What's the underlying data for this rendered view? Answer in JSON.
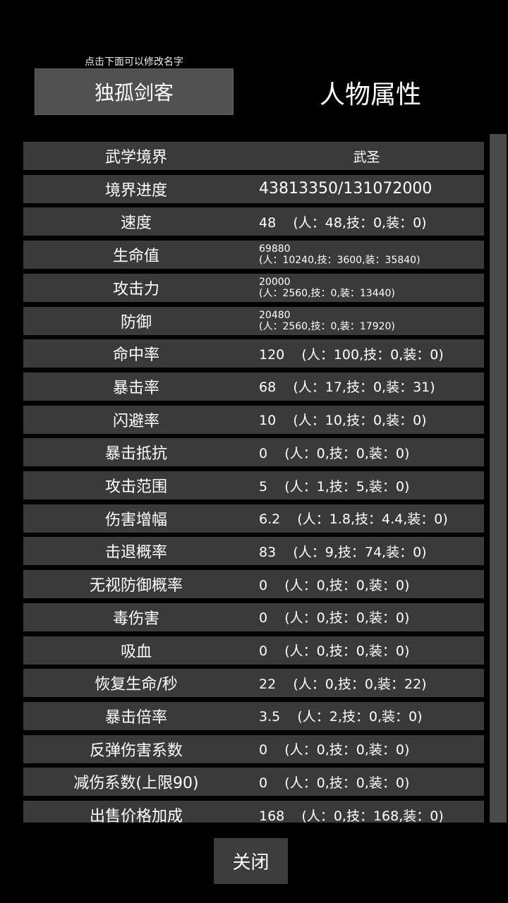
{
  "header": {
    "hint": "点击下面可以修改名字",
    "name": "独孤剑客",
    "title": "人物属性"
  },
  "stats": [
    {
      "label": "武学境界",
      "value": "武圣",
      "style": "center"
    },
    {
      "label": "境界进度",
      "value": "43813350/131072000",
      "style": "big"
    },
    {
      "label": "速度",
      "value": "48    (人：48,技：0,装：0)"
    },
    {
      "label": "生命值",
      "value": "69880",
      "value2": "(人：10240,技：3600,装：35840)",
      "style": "two"
    },
    {
      "label": "攻击力",
      "value": "20000",
      "value2": "(人：2560,技：0,装：13440)",
      "style": "two"
    },
    {
      "label": "防御",
      "value": "20480",
      "value2": "(人：2560,技：0,装：17920)",
      "style": "two"
    },
    {
      "label": "命中率",
      "value": "120    (人：100,技：0,装：0)"
    },
    {
      "label": "暴击率",
      "value": "68    (人：17,技：0,装：31)"
    },
    {
      "label": "闪避率",
      "value": "10    (人：10,技：0,装：0)"
    },
    {
      "label": "暴击抵抗",
      "value": "0    (人：0,技：0,装：0)"
    },
    {
      "label": "攻击范围",
      "value": "5    (人：1,技：5,装：0)"
    },
    {
      "label": "伤害增幅",
      "value": "6.2    (人：1.8,技：4.4,装：0)"
    },
    {
      "label": "击退概率",
      "value": "83    (人：9,技：74,装：0)"
    },
    {
      "label": "无视防御概率",
      "value": "0    (人：0,技：0,装：0)"
    },
    {
      "label": "毒伤害",
      "value": "0    (人：0,技：0,装：0)"
    },
    {
      "label": "吸血",
      "value": "0    (人：0,技：0,装：0)"
    },
    {
      "label": "恢复生命/秒",
      "value": "22    (人：0,技：0,装：22)"
    },
    {
      "label": "暴击倍率",
      "value": "3.5    (人：2,技：0,装：0)"
    },
    {
      "label": "反弹伤害系数",
      "value": "0    (人：0,技：0,装：0)"
    },
    {
      "label": "减伤系数(上限90)",
      "value": "0    (人：0,技：0,装：0)"
    },
    {
      "label": "出售价格加成",
      "value": "168    (人：0,技：168,装：0)"
    }
  ],
  "footer": {
    "close_label": "关闭"
  }
}
